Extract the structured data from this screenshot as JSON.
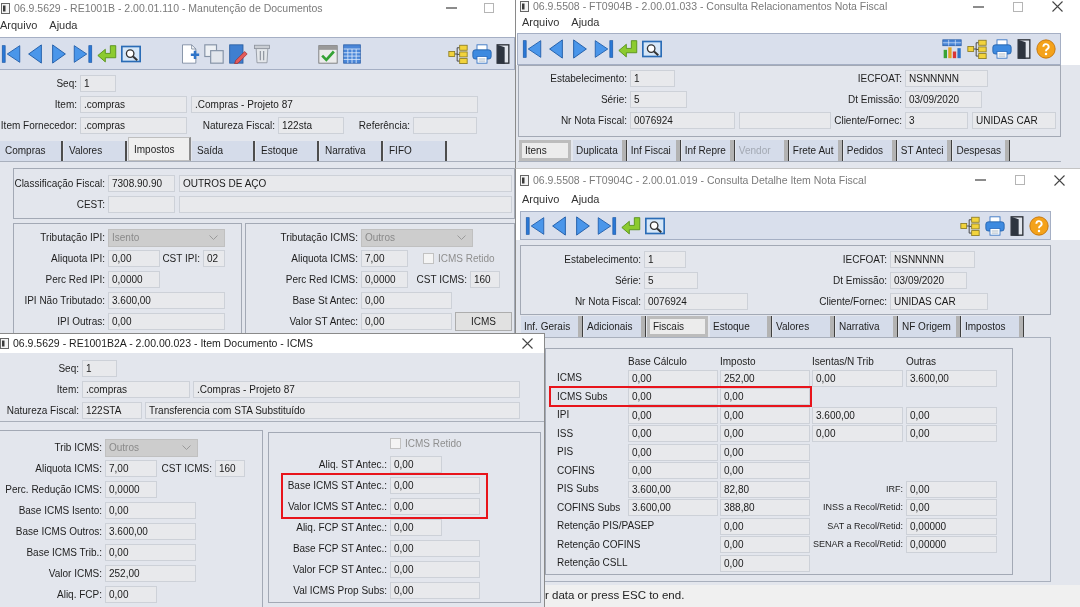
{
  "document_window": {
    "title": "06.9.5629 - RE1001B - 2.00.01.110 - Manutenção de Documentos",
    "active": false,
    "menu": [
      "Arquivo",
      "Ajuda"
    ],
    "header_rows": [
      [
        {
          "kind": "field",
          "label": "Seq:",
          "value": "1"
        }
      ],
      [
        {
          "kind": "field",
          "label": "Item:",
          "value": ".compras"
        },
        {
          "kind": "field",
          "value": ".Compras - Projeto 87"
        }
      ],
      [
        {
          "kind": "field",
          "label": "Item Fornecedor:",
          "value": ".compras"
        },
        {
          "kind": "field",
          "label": "Natureza Fiscal:",
          "value": "122sta"
        },
        {
          "kind": "field",
          "label": "Referência:"
        }
      ]
    ],
    "tabs": [
      {
        "label": "Compras",
        "selected": false
      },
      {
        "label": "Valores",
        "selected": false
      },
      {
        "label": "Impostos",
        "selected": true
      },
      {
        "label": "Saída",
        "selected": false
      },
      {
        "label": "Estoque",
        "selected": false
      },
      {
        "label": "Narrativa",
        "selected": false
      },
      {
        "label": "FIFO",
        "selected": false
      }
    ],
    "classification_rows": [
      [
        {
          "kind": "field",
          "label": "Classificação Fiscal:",
          "value": "7308.90.90"
        },
        {
          "kind": "field",
          "value": "OUTROS DE AÇO"
        }
      ],
      [
        {
          "kind": "field",
          "label": "CEST:"
        },
        {
          "kind": "field"
        }
      ]
    ],
    "ipi_rows": [
      [
        {
          "kind": "select",
          "label": "Tributação IPI:",
          "value": "Isento",
          "disabled": true
        }
      ],
      [
        {
          "kind": "field",
          "label": "Aliquota IPI:",
          "value": "0,00"
        },
        {
          "kind": "field",
          "label": "CST IPI:",
          "value": "02"
        }
      ],
      [
        {
          "kind": "field",
          "label": "Perc Red IPI:",
          "value": "0,0000"
        }
      ],
      [
        {
          "kind": "field",
          "label": "IPI Não Tributado:",
          "value": "3.600,00"
        }
      ],
      [
        {
          "kind": "field",
          "label": "IPI Outras:",
          "value": "0,00"
        }
      ]
    ],
    "icms_rows": [
      [
        {
          "kind": "select",
          "label": "Tributação ICMS:",
          "value": "Outros",
          "disabled": true
        }
      ],
      [
        {
          "kind": "field",
          "label": "Aliquota ICMS:",
          "value": "7,00"
        },
        {
          "kind": "checkbox",
          "label": "ICMS Retido",
          "checked": false,
          "disabled": true
        }
      ],
      [
        {
          "kind": "field",
          "label": "Perc Red ICMS:",
          "value": "0,0000"
        },
        {
          "kind": "field",
          "label": "CST ICMS:",
          "value": "160"
        }
      ],
      [
        {
          "kind": "field",
          "label": "Base St Antec:",
          "value": "0,00"
        }
      ],
      [
        {
          "kind": "field",
          "label": "Valor ST Antec:",
          "value": "0,00"
        },
        {
          "kind": "button",
          "label": "ICMS"
        }
      ]
    ]
  },
  "relations_window": {
    "title": "06.9.5508 - FT0904B - 2.00.01.033 - Consulta Relacionamentos Nota Fiscal",
    "active": false,
    "menu": [
      "Arquivo",
      "Ajuda"
    ],
    "header_rows": [
      [
        {
          "kind": "field",
          "label": "Estabelecimento:",
          "value": "1"
        },
        {
          "kind": "field",
          "label": "IECFOAT:",
          "value": "NSNNNNN"
        }
      ],
      [
        {
          "kind": "field",
          "label": "Série:",
          "value": "5"
        },
        {
          "kind": "field",
          "label": "Dt Emissão:",
          "value": "03/09/2020"
        }
      ],
      [
        {
          "kind": "field",
          "label": "Nr Nota Fiscal:",
          "value": "0076924"
        },
        {
          "kind": "field"
        },
        {
          "kind": "field",
          "label": "Cliente/Fornec:",
          "value": "3"
        },
        {
          "kind": "field",
          "value": "UNIDAS CAR"
        }
      ]
    ],
    "tabs": [
      {
        "label": "Itens",
        "selected": true,
        "disabled": false
      },
      {
        "label": "Duplicata",
        "selected": false,
        "disabled": false
      },
      {
        "label": "Inf Fiscai",
        "selected": false,
        "disabled": false
      },
      {
        "label": "Inf Repre",
        "selected": false,
        "disabled": false
      },
      {
        "label": "Vendor",
        "selected": false,
        "disabled": true
      },
      {
        "label": "Frete Aut",
        "selected": false,
        "disabled": false
      },
      {
        "label": "Pedidos",
        "selected": false,
        "disabled": false
      },
      {
        "label": "ST Anteci",
        "selected": false,
        "disabled": false
      },
      {
        "label": "Despesas",
        "selected": false,
        "disabled": false
      }
    ]
  },
  "item_detail_window": {
    "title": "06.9.5508 - FT0904C - 2.00.01.019 - Consulta Detalhe Item Nota Fiscal",
    "active": false,
    "menu": [
      "Arquivo",
      "Ajuda"
    ],
    "header_rows": [
      [
        {
          "kind": "field",
          "label": "Estabelecimento:",
          "value": "1"
        },
        {
          "kind": "field",
          "label": "IECFOAT:",
          "value": "NSNNNNN"
        }
      ],
      [
        {
          "kind": "field",
          "label": "Série:",
          "value": "5"
        },
        {
          "kind": "field",
          "label": "Dt Emissão:",
          "value": "03/09/2020"
        }
      ],
      [
        {
          "kind": "field",
          "label": "Nr Nota Fiscal:",
          "value": "0076924"
        },
        {
          "kind": "field",
          "label": "Cliente/Fornec:",
          "value": "UNIDAS CAR"
        }
      ]
    ],
    "tabs": [
      {
        "label": "Inf. Gerais",
        "selected": false
      },
      {
        "label": "Adicionais",
        "selected": false
      },
      {
        "label": "Fiscais",
        "selected": true
      },
      {
        "label": "Estoque",
        "selected": false
      },
      {
        "label": "Valores",
        "selected": false
      },
      {
        "label": "Narrativa",
        "selected": false
      },
      {
        "label": "NF Origem",
        "selected": false
      },
      {
        "label": "Impostos",
        "selected": false
      }
    ],
    "tax_table": {
      "columns": [
        "Base Cálculo",
        "Imposto",
        "Isentas/N Trib",
        "Outras"
      ],
      "rows": [
        {
          "label": "ICMS",
          "base": "0,00",
          "tax": "252,00",
          "exempt": "0,00",
          "other": "3.600,00",
          "highlighted": false
        },
        {
          "label": "ICMS Subs",
          "base": "0,00",
          "tax": "0,00",
          "highlighted": true
        },
        {
          "label": "IPI",
          "base": "0,00",
          "tax": "0,00",
          "exempt": "3.600,00",
          "other": "0,00",
          "highlighted": false
        },
        {
          "label": "ISS",
          "base": "0,00",
          "tax": "0,00",
          "exempt": "0,00",
          "other": "0,00",
          "highlighted": false
        },
        {
          "label": "PIS",
          "base": "0,00",
          "tax": "0,00",
          "highlighted": false
        },
        {
          "label": "COFINS",
          "base": "0,00",
          "tax": "0,00",
          "highlighted": false
        },
        {
          "label": "PIS Subs",
          "base": "3.600,00",
          "tax": "82,80",
          "side_label": "IRF:",
          "side_value": "0,00",
          "highlighted": false
        },
        {
          "label": "COFINS Subs",
          "base": "3.600,00",
          "tax": "388,80",
          "side_label": "INSS a Recol/Retid:",
          "side_value": "0,00",
          "highlighted": false
        },
        {
          "label": "Retenção PIS/PASEP",
          "tax": "0,00",
          "side_label": "SAT a Recol/Retid:",
          "side_value": "0,00000",
          "highlighted": false
        },
        {
          "label": "Retenção COFINS",
          "tax": "0,00",
          "side_label": "SENAR a Recol/Retid:",
          "side_value": "0,00000",
          "highlighted": false
        },
        {
          "label": "Retenção CSLL",
          "tax": "0,00",
          "highlighted": false
        }
      ]
    },
    "status_bar": "r data or press ESC to end."
  },
  "icms_dialog": {
    "title": "06.9.5629 - RE1001B2A - 2.00.00.023 - Item Documento - ICMS",
    "active": true,
    "header_rows": [
      [
        {
          "kind": "field",
          "label": "Seq:",
          "value": "1"
        }
      ],
      [
        {
          "kind": "field",
          "label": "Item:",
          "value": ".compras"
        },
        {
          "kind": "field",
          "value": ".Compras - Projeto 87"
        }
      ],
      [
        {
          "kind": "field",
          "label": "Natureza Fiscal:",
          "value": "122STA"
        },
        {
          "kind": "field",
          "value": "Transferencia com STA Substituído"
        }
      ]
    ],
    "left_rows": [
      [
        {
          "kind": "select",
          "label": "Trib ICMS:",
          "value": "Outros",
          "disabled": true
        }
      ],
      [
        {
          "kind": "field",
          "label": "Aliquota ICMS:",
          "value": "7,00"
        },
        {
          "kind": "field",
          "label": "CST ICMS:",
          "value": "160"
        }
      ],
      [
        {
          "kind": "field",
          "label": "Perc. Redução ICMS:",
          "value": "0,0000"
        }
      ],
      [
        {
          "kind": "field",
          "label": "Base ICMS Isento:",
          "value": "0,00"
        }
      ],
      [
        {
          "kind": "field",
          "label": "Base ICMS Outros:",
          "value": "3.600,00"
        }
      ],
      [
        {
          "kind": "field",
          "label": "Base ICMS Trib.:",
          "value": "0,00"
        }
      ],
      [
        {
          "kind": "field",
          "label": "Valor ICMS:",
          "value": "252,00"
        }
      ],
      [
        {
          "kind": "field",
          "label": "Aliq. FCP:",
          "value": "0,00"
        }
      ]
    ],
    "right_rows": [
      {
        "items": [
          {
            "kind": "checkbox",
            "label": "ICMS Retido",
            "checked": false,
            "disabled": true
          }
        ],
        "highlighted": false
      },
      {
        "items": [
          {
            "kind": "field",
            "label": "Aliq. ST Antec.:",
            "value": "0,00"
          }
        ],
        "highlighted": false
      },
      {
        "items": [
          {
            "kind": "field",
            "label": "Base ICMS ST Antec.:",
            "value": "0,00"
          }
        ],
        "highlighted": true
      },
      {
        "items": [
          {
            "kind": "field",
            "label": "Valor ICMS ST Antec.:",
            "value": "0,00"
          }
        ],
        "highlighted": true
      },
      {
        "items": [
          {
            "kind": "field",
            "label": "Aliq. FCP ST Antec.:",
            "value": "0,00"
          }
        ],
        "highlighted": false
      },
      {
        "items": [
          {
            "kind": "field",
            "label": "Base FCP ST Antec.:",
            "value": "0,00"
          }
        ],
        "highlighted": false
      },
      {
        "items": [
          {
            "kind": "field",
            "label": "Valor FCP ST Antec.:",
            "value": "0,00"
          }
        ],
        "highlighted": false
      },
      {
        "items": [
          {
            "kind": "field",
            "label": "Val ICMS Prop Subs:",
            "value": "0,00"
          }
        ],
        "highlighted": false
      }
    ]
  }
}
